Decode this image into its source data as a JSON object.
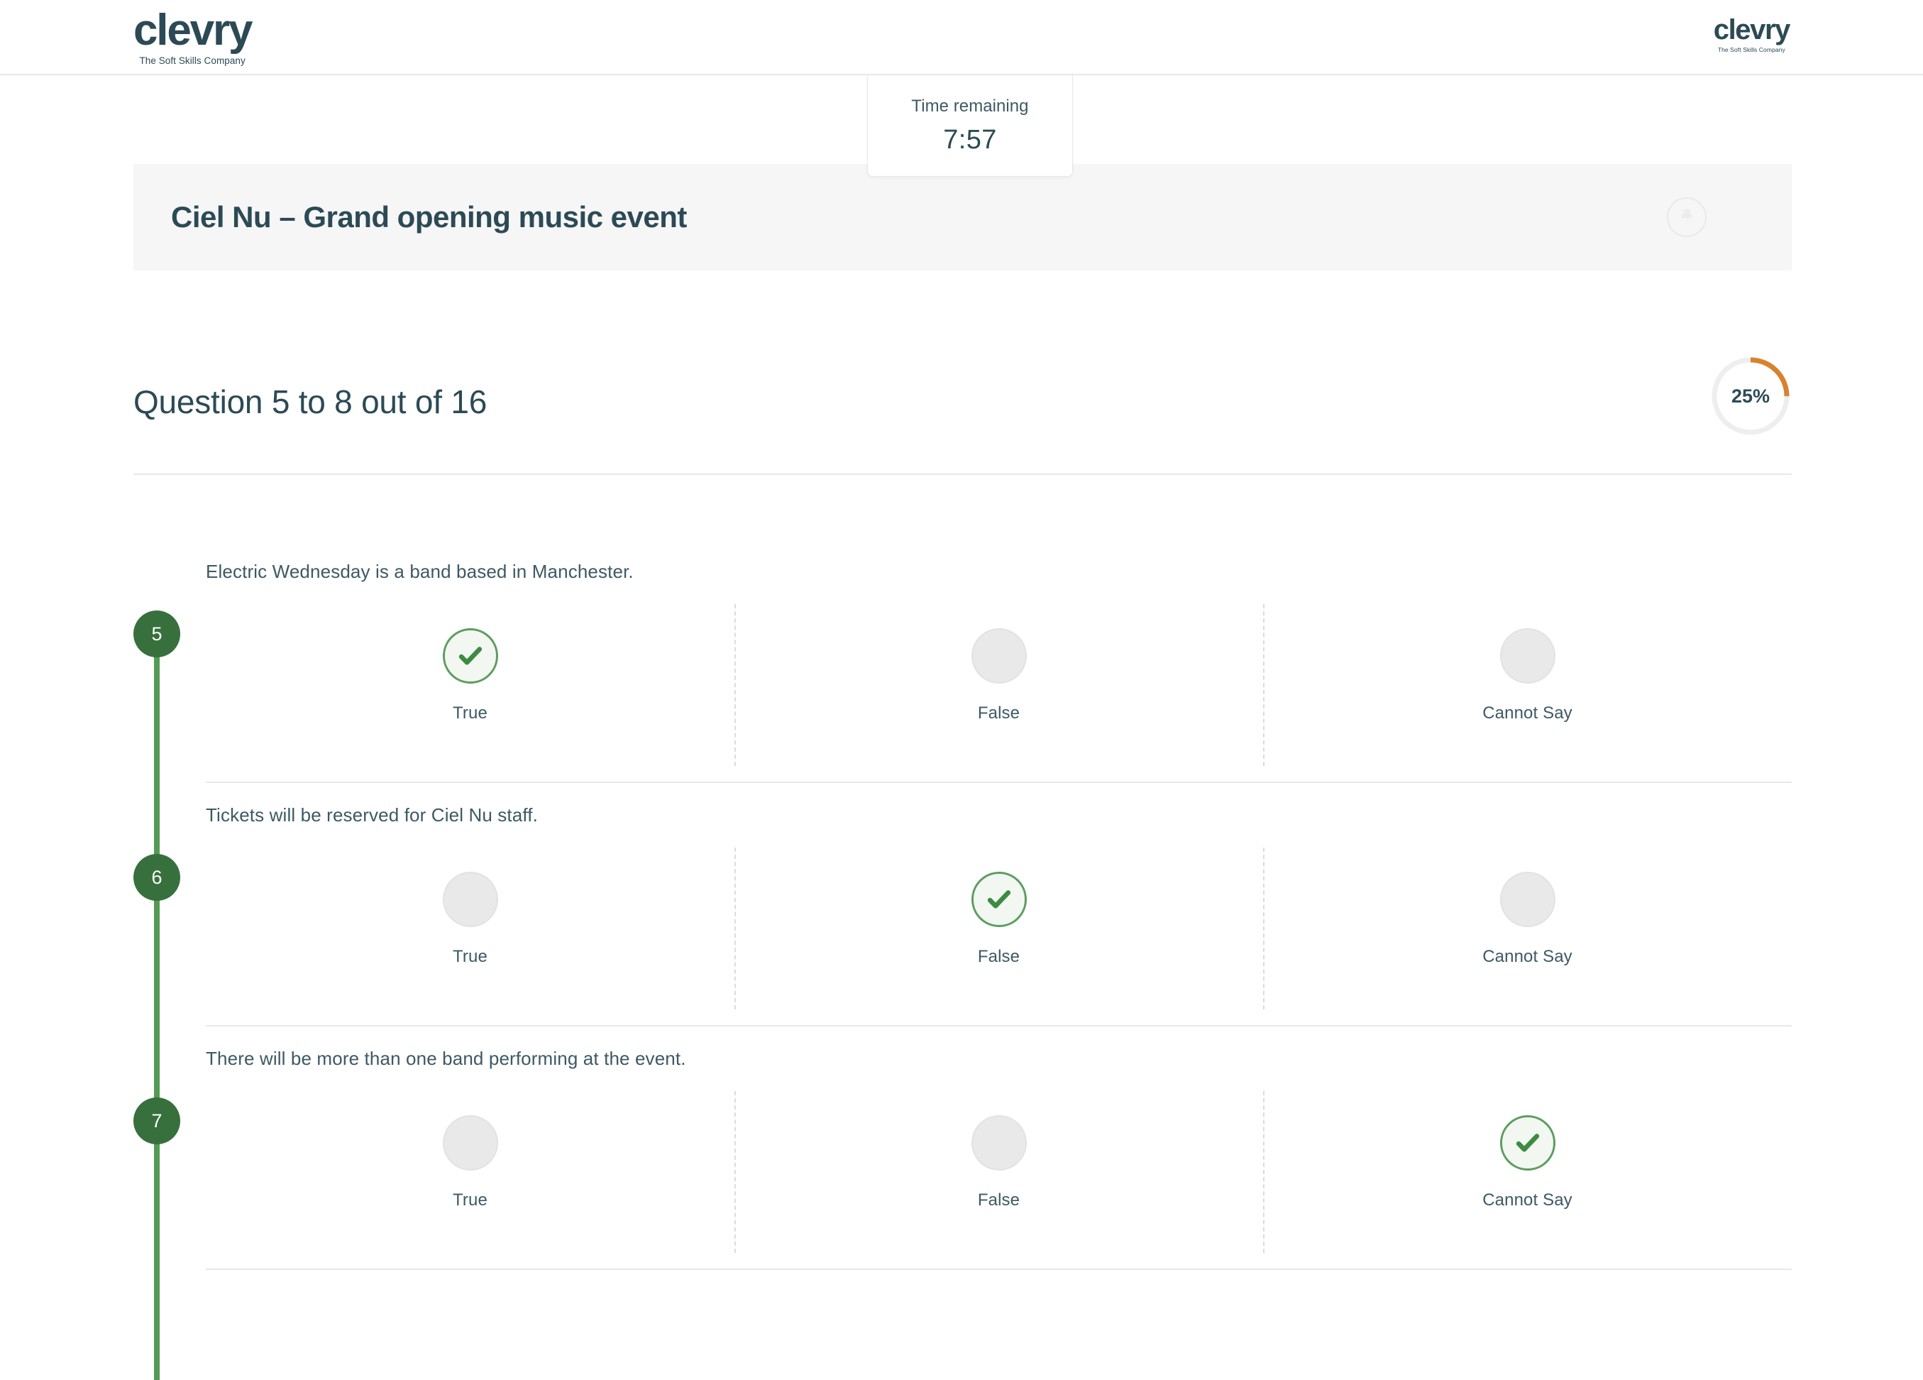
{
  "brand": {
    "name": "clevry",
    "tagline": "The Soft Skills Company",
    "primary_color": "#2c4a56",
    "accent_color": "#d8822f",
    "success_color": "#37703c"
  },
  "timer": {
    "label": "Time remaining",
    "value": "7:57"
  },
  "assessment": {
    "title": "Ciel Nu – Grand opening music event",
    "pin_icon": "pushpin-icon"
  },
  "progress": {
    "heading": "Question 5 to 8 out of 16",
    "percent_label": "25%",
    "percent_value": 25
  },
  "option_labels": [
    "True",
    "False",
    "Cannot Say"
  ],
  "questions": [
    {
      "number": "5",
      "stem": "Electric Wednesday is a band based in Manchester.",
      "selected_index": 0
    },
    {
      "number": "6",
      "stem": "Tickets will be reserved for Ciel Nu staff.",
      "selected_index": 1
    },
    {
      "number": "7",
      "stem": "There will be more than one band performing at the event.",
      "selected_index": 2
    }
  ]
}
